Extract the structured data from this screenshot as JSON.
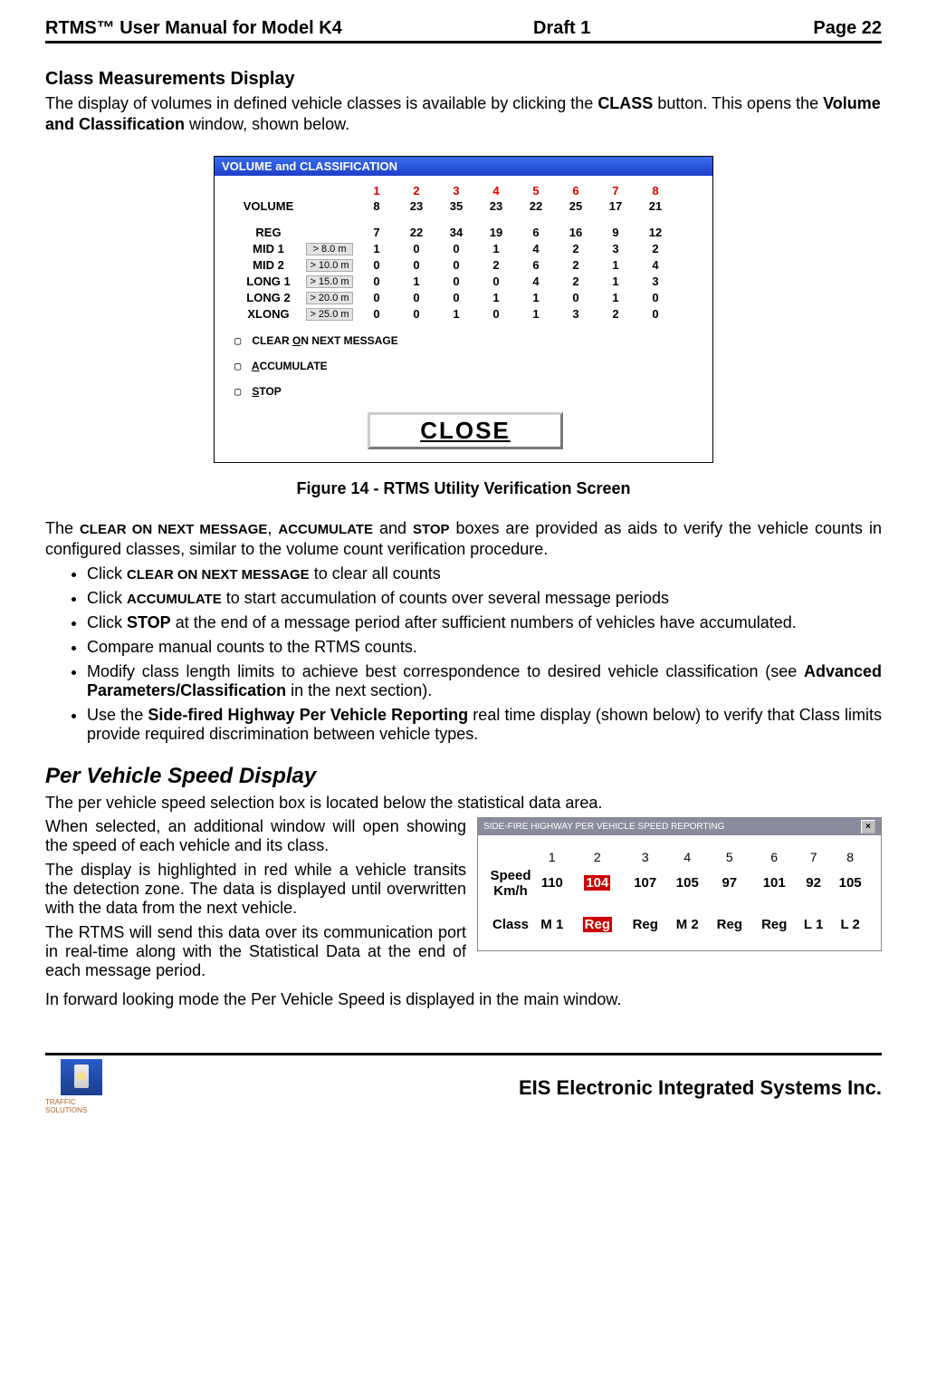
{
  "header": {
    "left": "RTMS™  User Manual for Model K4",
    "mid": "Draft 1",
    "right": "Page 22"
  },
  "section1": {
    "title": "Class Measurements Display",
    "para": "The display of volumes in defined vehicle classes is available by clicking the CLASS button. This opens the Volume and Classification window, shown below.",
    "bold1": "CLASS",
    "bold2": "Volume and Classification"
  },
  "win1": {
    "title": "VOLUME and CLASSIFICATION",
    "cols": [
      "1",
      "2",
      "3",
      "4",
      "5",
      "6",
      "7",
      "8"
    ],
    "rows": [
      {
        "label": "VOLUME",
        "thresh": "",
        "vals": [
          "8",
          "23",
          "35",
          "23",
          "22",
          "25",
          "17",
          "21"
        ]
      },
      {
        "label": "REG",
        "thresh": "",
        "vals": [
          "7",
          "22",
          "34",
          "19",
          "6",
          "16",
          "9",
          "12"
        ]
      },
      {
        "label": "MID 1",
        "thresh": "> 8.0 m",
        "vals": [
          "1",
          "0",
          "0",
          "1",
          "4",
          "2",
          "3",
          "2"
        ]
      },
      {
        "label": "MID 2",
        "thresh": "> 10.0 m",
        "vals": [
          "0",
          "0",
          "0",
          "2",
          "6",
          "2",
          "1",
          "4"
        ]
      },
      {
        "label": "LONG 1",
        "thresh": "> 15.0 m",
        "vals": [
          "0",
          "1",
          "0",
          "0",
          "4",
          "2",
          "1",
          "3"
        ]
      },
      {
        "label": "LONG 2",
        "thresh": "> 20.0 m",
        "vals": [
          "0",
          "0",
          "0",
          "1",
          "1",
          "0",
          "1",
          "0"
        ]
      },
      {
        "label": "XLONG",
        "thresh": "> 25.0 m",
        "vals": [
          "0",
          "0",
          "1",
          "0",
          "1",
          "3",
          "2",
          "0"
        ]
      }
    ],
    "check1": "CLEAR ON NEXT MESSAGE",
    "check2": "ACCUMULATE",
    "check3": "STOP",
    "close": "CLOSE"
  },
  "caption1": "Figure 14 - RTMS Utility Verification Screen",
  "para2": {
    "text": "The CLEAR ON NEXT MESSAGE, ACCUMULATE and STOP boxes are provided as aids to verify the vehicle counts in configured classes, similar to the volume count verification procedure.",
    "b1": "CLEAR ON NEXT MESSAGE",
    "b2": "ACCUMULATE",
    "b3": "STOP"
  },
  "bullets": [
    {
      "pre": "Click ",
      "bold": "CLEAR ON NEXT MESSAGE",
      "post": "  to clear all counts",
      "small": true
    },
    {
      "pre": "Click ",
      "bold": "ACCUMULATE",
      "post": "  to start accumulation of counts over several message periods",
      "small": true
    },
    {
      "pre": "Click ",
      "bold": "STOP",
      "post": " at the end of a message period after sufficient numbers of vehicles have accumulated.",
      "small": false
    },
    {
      "pre": "Compare manual counts to the RTMS counts.",
      "bold": "",
      "post": "",
      "small": false
    },
    {
      "pre": "Modify class length limits to achieve best correspondence to desired vehicle classification (see ",
      "bold": "Advanced Parameters/Classification",
      "post": " in the next section).",
      "small": false
    },
    {
      "pre": "Use the ",
      "bold": "Side-fired Highway Per Vehicle Reporting",
      "post": " real time display (shown below) to verify that Class limits provide required discrimination between vehicle types.",
      "small": false
    }
  ],
  "section2": {
    "title": "Per Vehicle Speed Display",
    "p1": "The per vehicle speed selection box is located below the statistical data area.",
    "p2": "When selected, an additional window will open showing the speed of each vehicle and its class.",
    "p3": "The display is highlighted in red while a vehicle transits the detection zone.  The data is displayed until overwritten with the data from the next vehicle.",
    "p4": "The RTMS will send this data over its communication port in real-time along with the Statistical Data at the end of each message period.",
    "p5": "In forward looking mode the Per Vehicle Speed is displayed in the main window."
  },
  "win2": {
    "title": "SIDE-FIRE HIGHWAY PER VEHICLE SPEED REPORTING",
    "cols": [
      "1",
      "2",
      "3",
      "4",
      "5",
      "6",
      "7",
      "8"
    ],
    "speedLabel": "Speed Km/h",
    "speeds": [
      "110",
      "104",
      "107",
      "105",
      "97",
      "101",
      "92",
      "105"
    ],
    "classLabel": "Class",
    "classes": [
      "M 1",
      "Reg",
      "Reg",
      "M 2",
      "Reg",
      "Reg",
      "L 1",
      "L 2"
    ],
    "hlIndex": 1
  },
  "footer": {
    "logo": "TRAFFIC SOLUTIONS",
    "company": "EIS Electronic Integrated Systems Inc."
  }
}
